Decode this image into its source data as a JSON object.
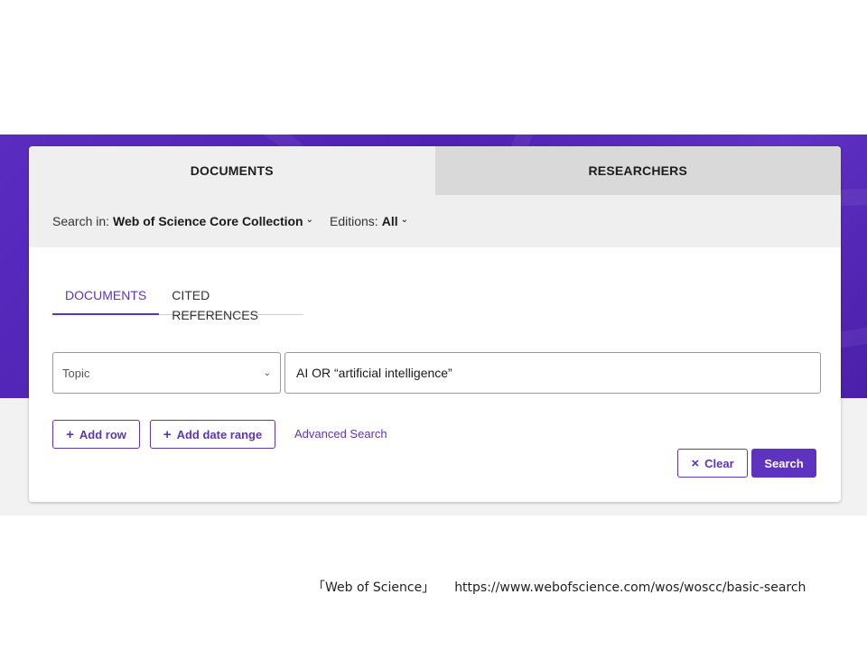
{
  "top_tabs": {
    "documents": "DOCUMENTS",
    "researchers": "RESEARCHERS"
  },
  "search_in": {
    "label": "Search in:",
    "value": "Web of Science Core Collection",
    "editions_label": "Editions:",
    "editions_value": "All"
  },
  "sub_tabs": {
    "documents": "DOCUMENTS",
    "cited_references": "CITED REFERENCES"
  },
  "query": {
    "field": "Topic",
    "value": "AI OR “artificial intelligence”"
  },
  "buttons": {
    "add_row": "Add row",
    "add_date_range": "Add date range",
    "advanced_search": "Advanced Search",
    "clear": "Clear",
    "search": "Search"
  },
  "icons": {
    "plus": "plus-icon",
    "close": "close-icon",
    "chevron": "chevron-down-icon"
  },
  "colors": {
    "accent": "#5e33bf",
    "hero": "#5126b6"
  },
  "caption": {
    "source": "「Web of Science」",
    "url": "https://www.webofscience.com/wos/woscc/basic-search"
  }
}
